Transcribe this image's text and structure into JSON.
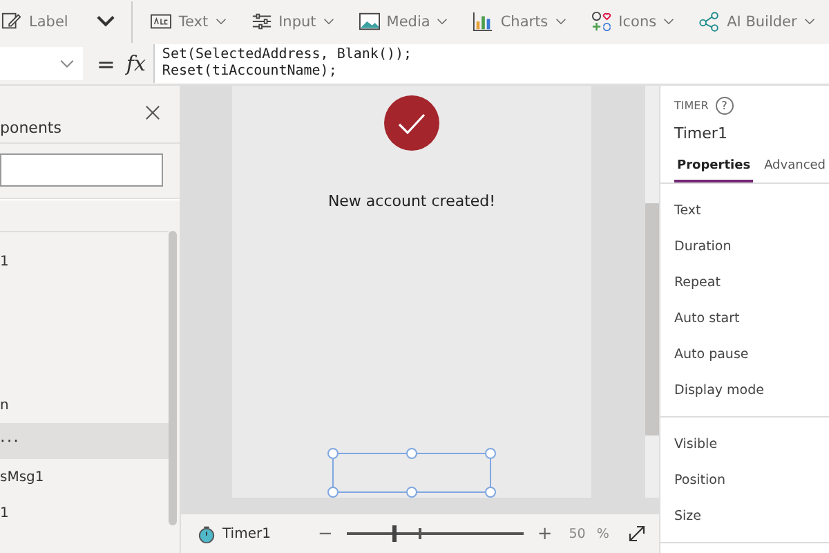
{
  "toolbar": {
    "items": [
      {
        "kind": "label",
        "label": "Label"
      },
      {
        "kind": "chevron"
      },
      {
        "kind": "text",
        "label": "Text"
      },
      {
        "kind": "input",
        "label": "Input"
      },
      {
        "kind": "media",
        "label": "Media"
      },
      {
        "kind": "charts",
        "label": "Charts"
      },
      {
        "kind": "icons",
        "label": "Icons"
      },
      {
        "kind": "ai",
        "label": "AI Builder"
      }
    ]
  },
  "formula_bar": {
    "equals": "=",
    "fx": "fx",
    "lines": [
      "Set(SelectedAddress, Blank());",
      "Reset(tiAccountName);"
    ]
  },
  "tree_panel": {
    "title": "ponents",
    "items": [
      {
        "kind": "item",
        "label": "1",
        "selected": false
      },
      {
        "kind": "blank"
      },
      {
        "kind": "blank"
      },
      {
        "kind": "blank"
      },
      {
        "kind": "item",
        "label": "n",
        "selected": false
      },
      {
        "kind": "item",
        "selected": true,
        "more": "···"
      },
      {
        "kind": "item",
        "label": "sMsg1",
        "selected": false
      },
      {
        "kind": "item",
        "label": "1",
        "selected": false
      }
    ]
  },
  "screen": {
    "message": "New account created!"
  },
  "status_bar": {
    "control": "Timer1",
    "minus": "−",
    "plus": "+",
    "zoom": {
      "level": 0.26
    },
    "zoom_value": "50",
    "percent": "%"
  },
  "properties_panel": {
    "type": "TIMER",
    "help": "?",
    "name": "Timer1",
    "tabs": [
      {
        "label": "Properties",
        "selected": true
      },
      {
        "label": "Advanced",
        "selected": false
      }
    ],
    "groups": [
      [
        "Text",
        "Duration",
        "Repeat",
        "Auto start",
        "Auto pause",
        "Display mode"
      ],
      [
        "Visible",
        "Position",
        "Size"
      ]
    ]
  }
}
